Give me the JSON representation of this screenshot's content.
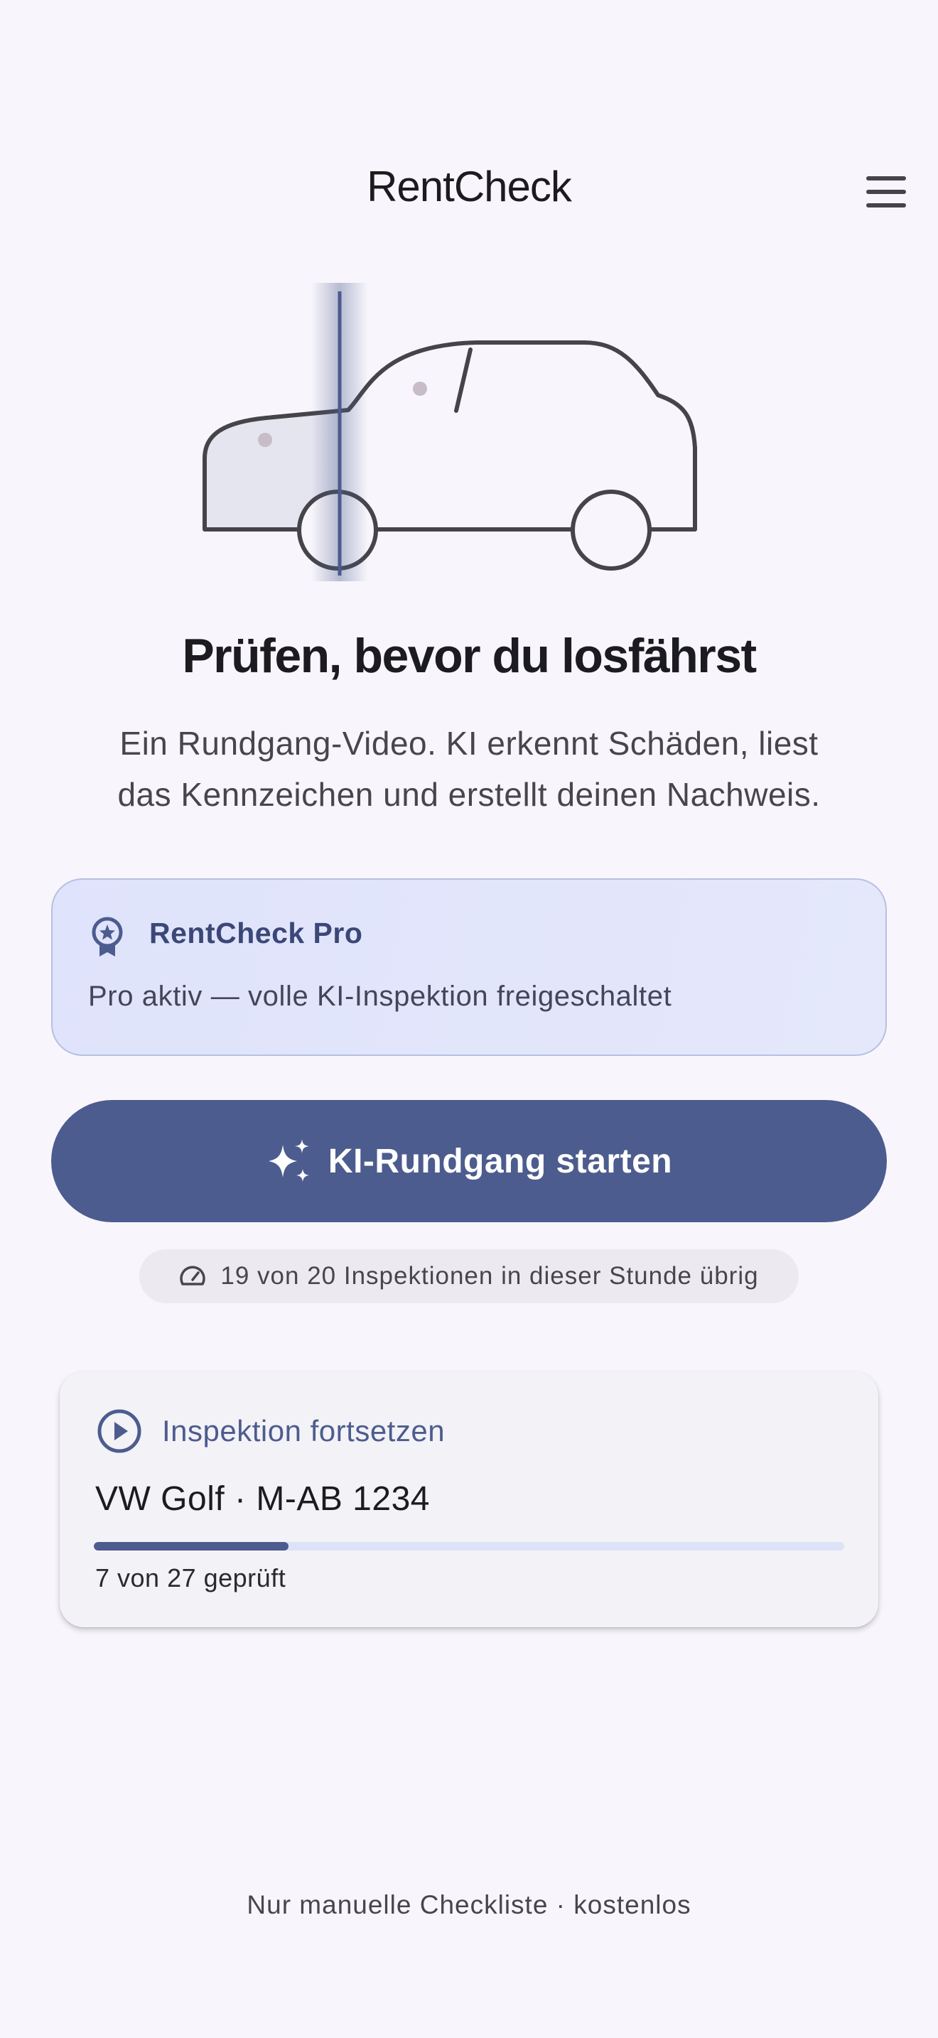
{
  "header": {
    "title": "RentCheck",
    "menu_icon": "hamburger-menu-icon"
  },
  "hero": {
    "illustration": "car-scan-illustration",
    "headline": "Prüfen, bevor du losfährst",
    "subtitle_line1": "Ein Rundgang-Video. KI erkennt Schäden, liest",
    "subtitle_line2": "das Kennzeichen und erstellt deinen Nachweis."
  },
  "pro_card": {
    "icon": "award-badge-icon",
    "title": "RentCheck Pro",
    "description": "Pro aktiv — volle KI-Inspektion freigeschaltet"
  },
  "start_button": {
    "icon": "sparkle-icon",
    "label": "KI-Rundgang starten"
  },
  "quota": {
    "icon": "gauge-icon",
    "text": "19 von 20 Inspektionen in dieser Stunde übrig"
  },
  "resume_card": {
    "icon": "play-circle-icon",
    "label": "Inspektion fortsetzen",
    "vehicle": "VW Golf · M-AB 1234",
    "progress_checked": 7,
    "progress_total": 27,
    "progress_text": "7 von 27 geprüft"
  },
  "footer": {
    "link": "Nur manuelle Checkliste · kostenlos"
  },
  "colors": {
    "primary": "#4d5c8e",
    "background": "#f8f6fc",
    "pro_card_bg": "#e2e6fb",
    "progress_track": "#dde2f7"
  }
}
